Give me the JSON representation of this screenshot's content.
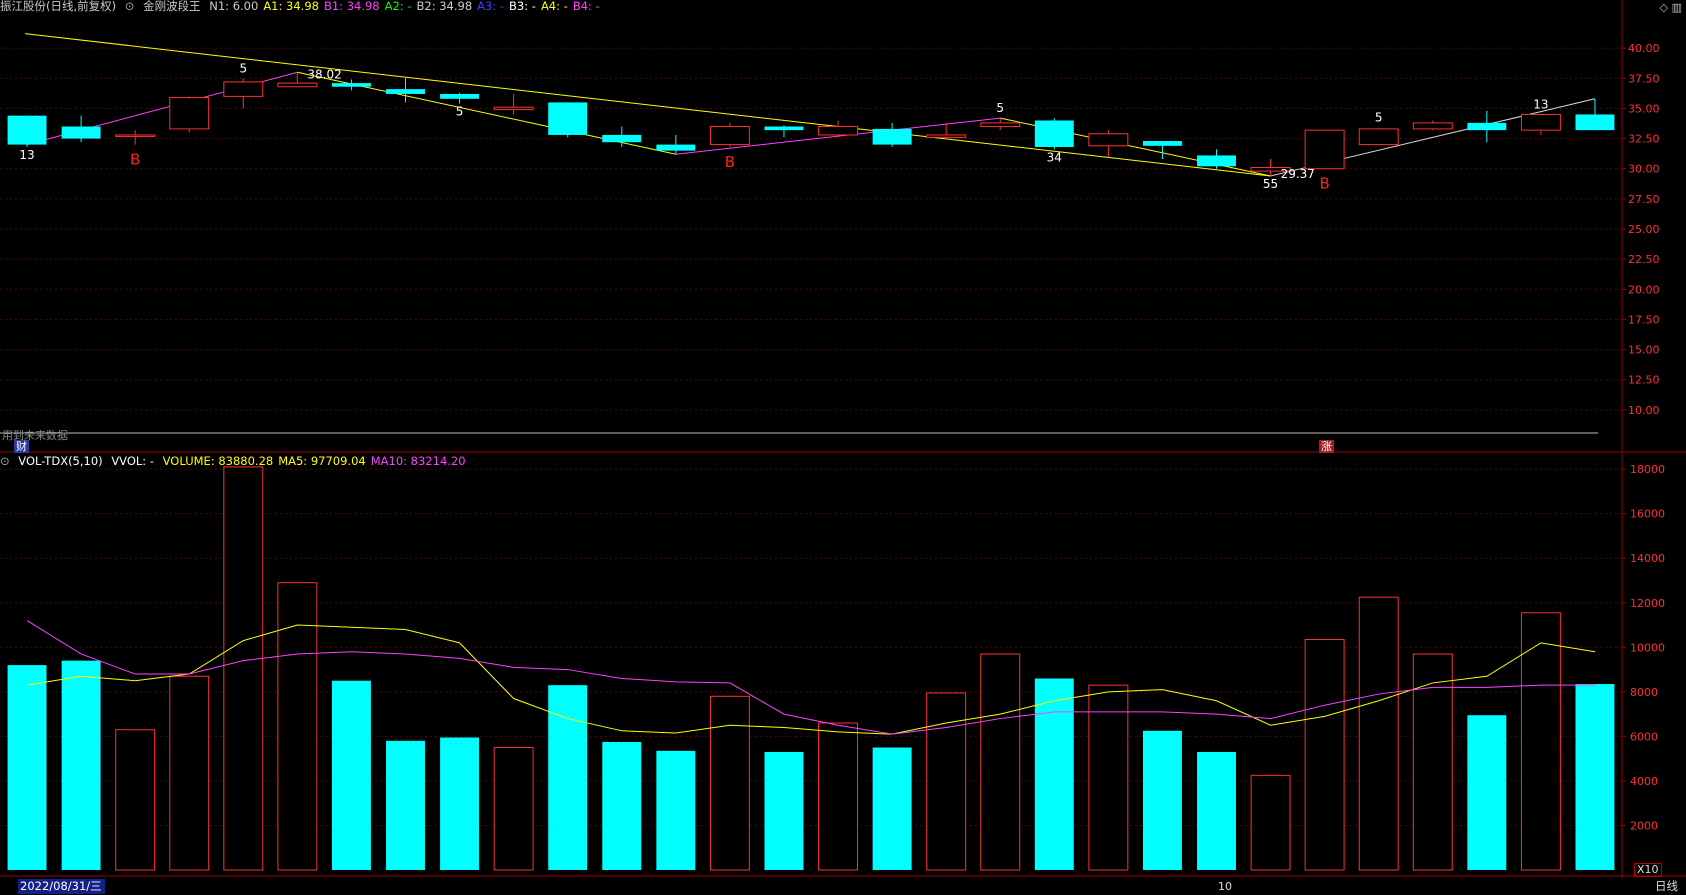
{
  "header": {
    "stock_label": "振江股份(日线,前复权)",
    "indicator_name": "金刚波段王",
    "params": [
      {
        "text": "N1: 6.00",
        "color": "#cccccc"
      },
      {
        "text": "A1: 34.98",
        "color": "#ffff00"
      },
      {
        "text": "B1: 34.98",
        "color": "#ff40ff"
      },
      {
        "text": "A2: -",
        "color": "#00ff00"
      },
      {
        "text": "B2: 34.98",
        "color": "#cccccc"
      },
      {
        "text": "A3: -",
        "color": "#4040ff"
      },
      {
        "text": "B3: -",
        "color": "#ffffff"
      },
      {
        "text": "A4: -",
        "color": "#ffff00"
      },
      {
        "text": "B4: -",
        "color": "#ff40ff"
      }
    ],
    "corner_icons": [
      "diamond-icon",
      "settings-icon"
    ]
  },
  "price_axis": {
    "ticks": [
      "40.00",
      "37.50",
      "35.00",
      "32.50",
      "30.00",
      "27.50",
      "25.00",
      "22.50",
      "20.00",
      "17.50",
      "15.00",
      "12.50",
      "10.00"
    ]
  },
  "volume_axis": {
    "ticks": [
      "18000",
      "16000",
      "14000",
      "12000",
      "10000",
      "8000",
      "6000",
      "4000",
      "2000"
    ]
  },
  "volume_header": {
    "name": "VOL-TDX(5,10)",
    "vvol": "VVOL: -",
    "values": [
      {
        "text": "VOLUME: 83880.28",
        "color": "#ffff00"
      },
      {
        "text": "MA5: 97709.04",
        "color": "#ffff00"
      },
      {
        "text": "MA10: 83214.20",
        "color": "#ff40ff"
      }
    ]
  },
  "overlay": {
    "future_data_text": "用到未来数据",
    "cai_label": "财",
    "zhang_label": "涨"
  },
  "status": {
    "date": "2022/08/31/三",
    "period": "日线",
    "multiplier": "X10",
    "month_marker": "10"
  },
  "chart_data": {
    "type": "candlestick",
    "ylim": [
      7.5,
      42.5
    ],
    "vol_ylim": [
      0,
      18500
    ],
    "candles": [
      {
        "o": 34.4,
        "c": 32.0,
        "h": 34.4,
        "l": 31.8,
        "v": 9200
      },
      {
        "o": 33.5,
        "c": 32.5,
        "h": 34.4,
        "l": 32.2,
        "v": 9400
      },
      {
        "o": 32.8,
        "c": 32.8,
        "h": 33.2,
        "l": 32.0,
        "v": 6300
      },
      {
        "o": 33.3,
        "c": 35.9,
        "h": 36.0,
        "l": 33.0,
        "v": 8700
      },
      {
        "o": 36.0,
        "c": 37.2,
        "h": 37.5,
        "l": 35.0,
        "v": 18100
      },
      {
        "o": 36.8,
        "c": 37.1,
        "h": 38.0,
        "l": 36.8,
        "v": 12900
      },
      {
        "o": 37.1,
        "c": 36.8,
        "h": 37.4,
        "l": 36.5,
        "v": 8500
      },
      {
        "o": 36.6,
        "c": 36.2,
        "h": 37.5,
        "l": 35.5,
        "v": 5800
      },
      {
        "o": 36.2,
        "c": 35.8,
        "h": 36.3,
        "l": 35.4,
        "v": 5950
      },
      {
        "o": 34.9,
        "c": 35.1,
        "h": 36.2,
        "l": 34.5,
        "v": 5500
      },
      {
        "o": 35.5,
        "c": 32.8,
        "h": 35.5,
        "l": 32.6,
        "v": 8300
      },
      {
        "o": 32.8,
        "c": 32.2,
        "h": 33.5,
        "l": 31.8,
        "v": 5750
      },
      {
        "o": 32.0,
        "c": 31.5,
        "h": 32.8,
        "l": 31.2,
        "v": 5350
      },
      {
        "o": 32.0,
        "c": 33.5,
        "h": 33.8,
        "l": 31.8,
        "v": 7800
      },
      {
        "o": 33.5,
        "c": 33.2,
        "h": 33.6,
        "l": 32.6,
        "v": 5300
      },
      {
        "o": 32.8,
        "c": 33.5,
        "h": 34.0,
        "l": 32.6,
        "v": 6600
      },
      {
        "o": 33.3,
        "c": 32.0,
        "h": 33.8,
        "l": 31.8,
        "v": 5500
      },
      {
        "o": 32.6,
        "c": 32.8,
        "h": 33.8,
        "l": 32.4,
        "v": 7950
      },
      {
        "o": 33.5,
        "c": 33.8,
        "h": 34.2,
        "l": 33.2,
        "v": 9700
      },
      {
        "o": 34.0,
        "c": 31.8,
        "h": 34.2,
        "l": 31.6,
        "v": 8600
      },
      {
        "o": 31.9,
        "c": 32.9,
        "h": 33.2,
        "l": 31.0,
        "v": 8300
      },
      {
        "o": 32.3,
        "c": 31.9,
        "h": 32.3,
        "l": 30.8,
        "v": 6250
      },
      {
        "o": 31.1,
        "c": 30.2,
        "h": 31.6,
        "l": 30.0,
        "v": 5300
      },
      {
        "o": 29.8,
        "c": 30.1,
        "h": 30.8,
        "l": 29.4,
        "v": 4250
      },
      {
        "o": 30.0,
        "c": 33.2,
        "h": 33.2,
        "l": 30.0,
        "v": 10350
      },
      {
        "o": 32.0,
        "c": 33.3,
        "h": 33.4,
        "l": 32.0,
        "v": 12250
      },
      {
        "o": 33.3,
        "c": 33.8,
        "h": 34.0,
        "l": 33.2,
        "v": 9700
      },
      {
        "o": 33.8,
        "c": 33.2,
        "h": 34.8,
        "l": 32.2,
        "v": 6950
      },
      {
        "o": 33.2,
        "c": 34.5,
        "h": 34.5,
        "l": 32.8,
        "v": 11550
      },
      {
        "o": 34.5,
        "c": 33.2,
        "h": 35.8,
        "l": 33.2,
        "v": 8350
      }
    ],
    "series": [
      {
        "name": "MA5",
        "values": [
          8300,
          8700,
          8500,
          8800,
          10300,
          11000,
          10900,
          10800,
          10200,
          7700,
          6800,
          6250,
          6150,
          6500,
          6400,
          6200,
          6100,
          6600,
          7000,
          7600,
          8000,
          8100,
          7600,
          6500,
          6900,
          7600,
          8400,
          8700,
          10200,
          9800
        ]
      },
      {
        "name": "MA10",
        "values": [
          11200,
          9700,
          8800,
          8800,
          9400,
          9700,
          9800,
          9700,
          9500,
          9100,
          9000,
          8600,
          8450,
          8400,
          7000,
          6500,
          6100,
          6400,
          6800,
          7100,
          7100,
          7100,
          7000,
          6800,
          7400,
          7900,
          8200,
          8200,
          8300,
          8300
        ]
      }
    ],
    "signal_labels": [
      {
        "i": 0,
        "text": "13",
        "color": "#ffffff",
        "pos": "below"
      },
      {
        "i": 2,
        "text": "B",
        "color": "#ff2020",
        "pos": "below"
      },
      {
        "i": 4,
        "text": "5",
        "color": "#ffffff",
        "pos": "above"
      },
      {
        "i": 8,
        "text": "5",
        "color": "#ffffff",
        "pos": "below"
      },
      {
        "i": 13,
        "text": "B",
        "color": "#ff2020",
        "pos": "below"
      },
      {
        "i": 18,
        "text": "5",
        "color": "#ffffff",
        "pos": "above"
      },
      {
        "i": 19,
        "text": "34",
        "color": "#ffffff",
        "pos": "below"
      },
      {
        "i": 23,
        "text": "55",
        "color": "#ffffff",
        "pos": "below"
      },
      {
        "i": 24,
        "text": "B",
        "color": "#ff2020",
        "pos": "below"
      },
      {
        "i": 25,
        "text": "5",
        "color": "#ffffff",
        "pos": "above"
      },
      {
        "i": 28,
        "text": "13",
        "color": "#ffffff",
        "pos": "above"
      }
    ],
    "price_notes": [
      {
        "i": 5,
        "text": "38.02"
      },
      {
        "i": 23,
        "text": "29.37"
      }
    ]
  }
}
